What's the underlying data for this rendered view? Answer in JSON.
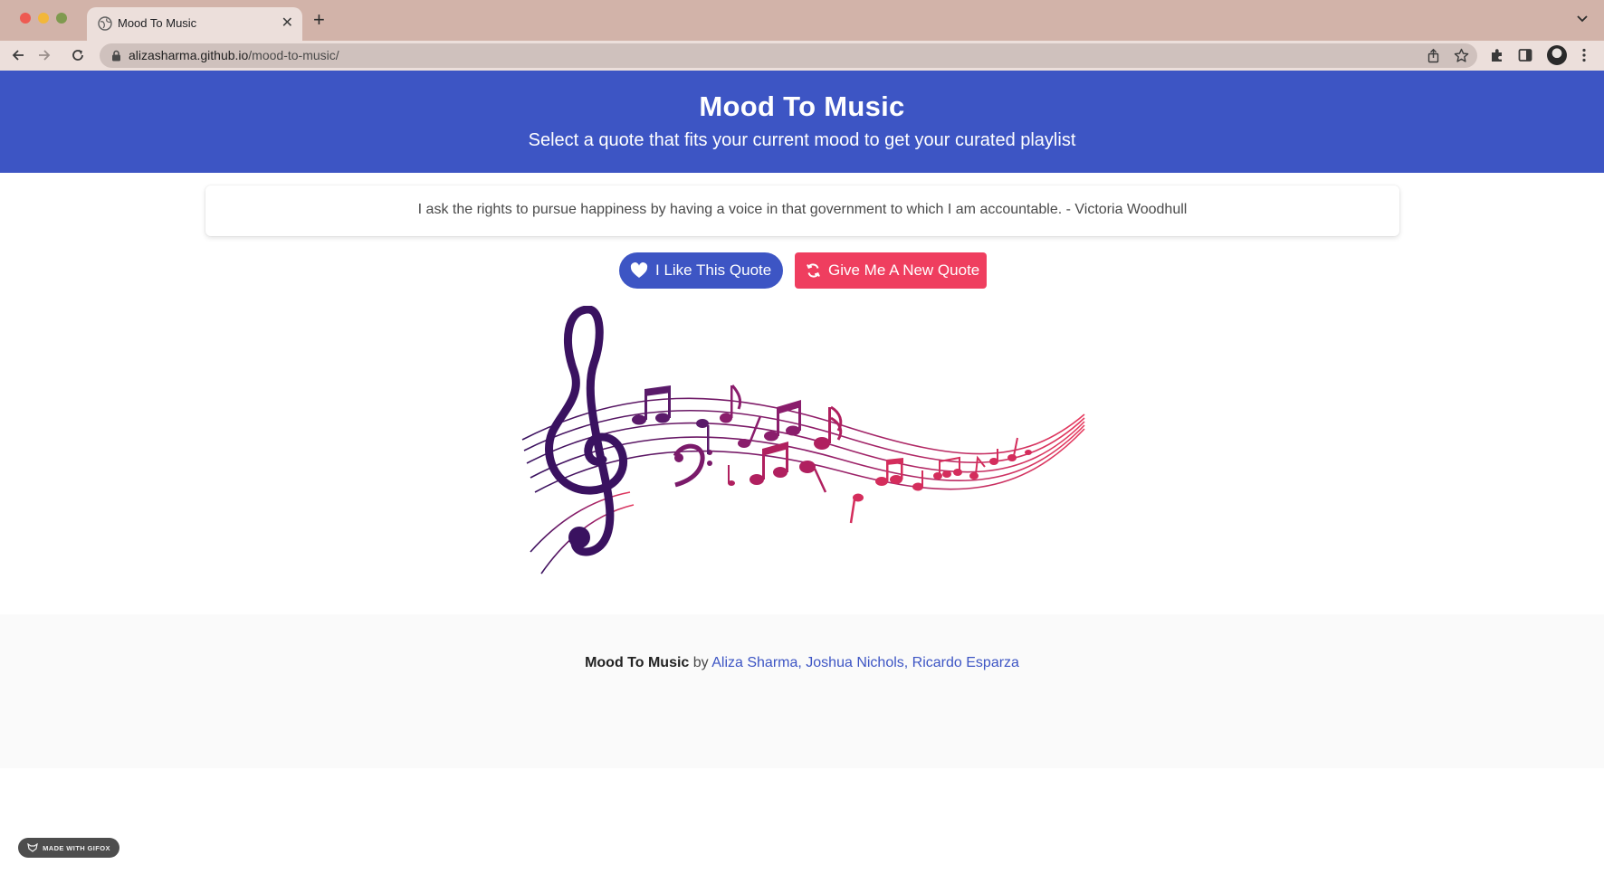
{
  "browser": {
    "tab": {
      "title": "Mood To Music",
      "close_glyph": "✕"
    },
    "new_tab_glyph": "+",
    "address": {
      "host": "alizasharma.github.io",
      "path": "/mood-to-music/"
    },
    "icons": [
      "back-arrow-icon",
      "forward-arrow-icon",
      "reload-icon",
      "lock-icon",
      "share-icon",
      "star-icon",
      "extensions-icon",
      "sidebar-icon",
      "profile-avatar",
      "kebab-menu-icon"
    ]
  },
  "header": {
    "title": "Mood To Music",
    "subtitle": "Select a quote that fits your current mood to get your curated playlist"
  },
  "quote": {
    "text": "I ask the rights to pursue happiness by having a voice in that government to which I am accountable. - Victoria Woodhull"
  },
  "buttons": {
    "like_label": "I Like This Quote",
    "new_label": "Give Me A New Quote"
  },
  "footer": {
    "app_name": "Mood To Music",
    "by": "by",
    "authors": "Aliza Sharma, Joshua Nichols, Ricardo Esparza"
  },
  "badge": {
    "label": "MADE WITH GIFOX"
  },
  "colors": {
    "primary": "#3d55c4",
    "danger": "#ef3e5f",
    "chrome": "#d2b3a9",
    "art_start": "#3a1260",
    "art_end": "#e63a5e"
  }
}
